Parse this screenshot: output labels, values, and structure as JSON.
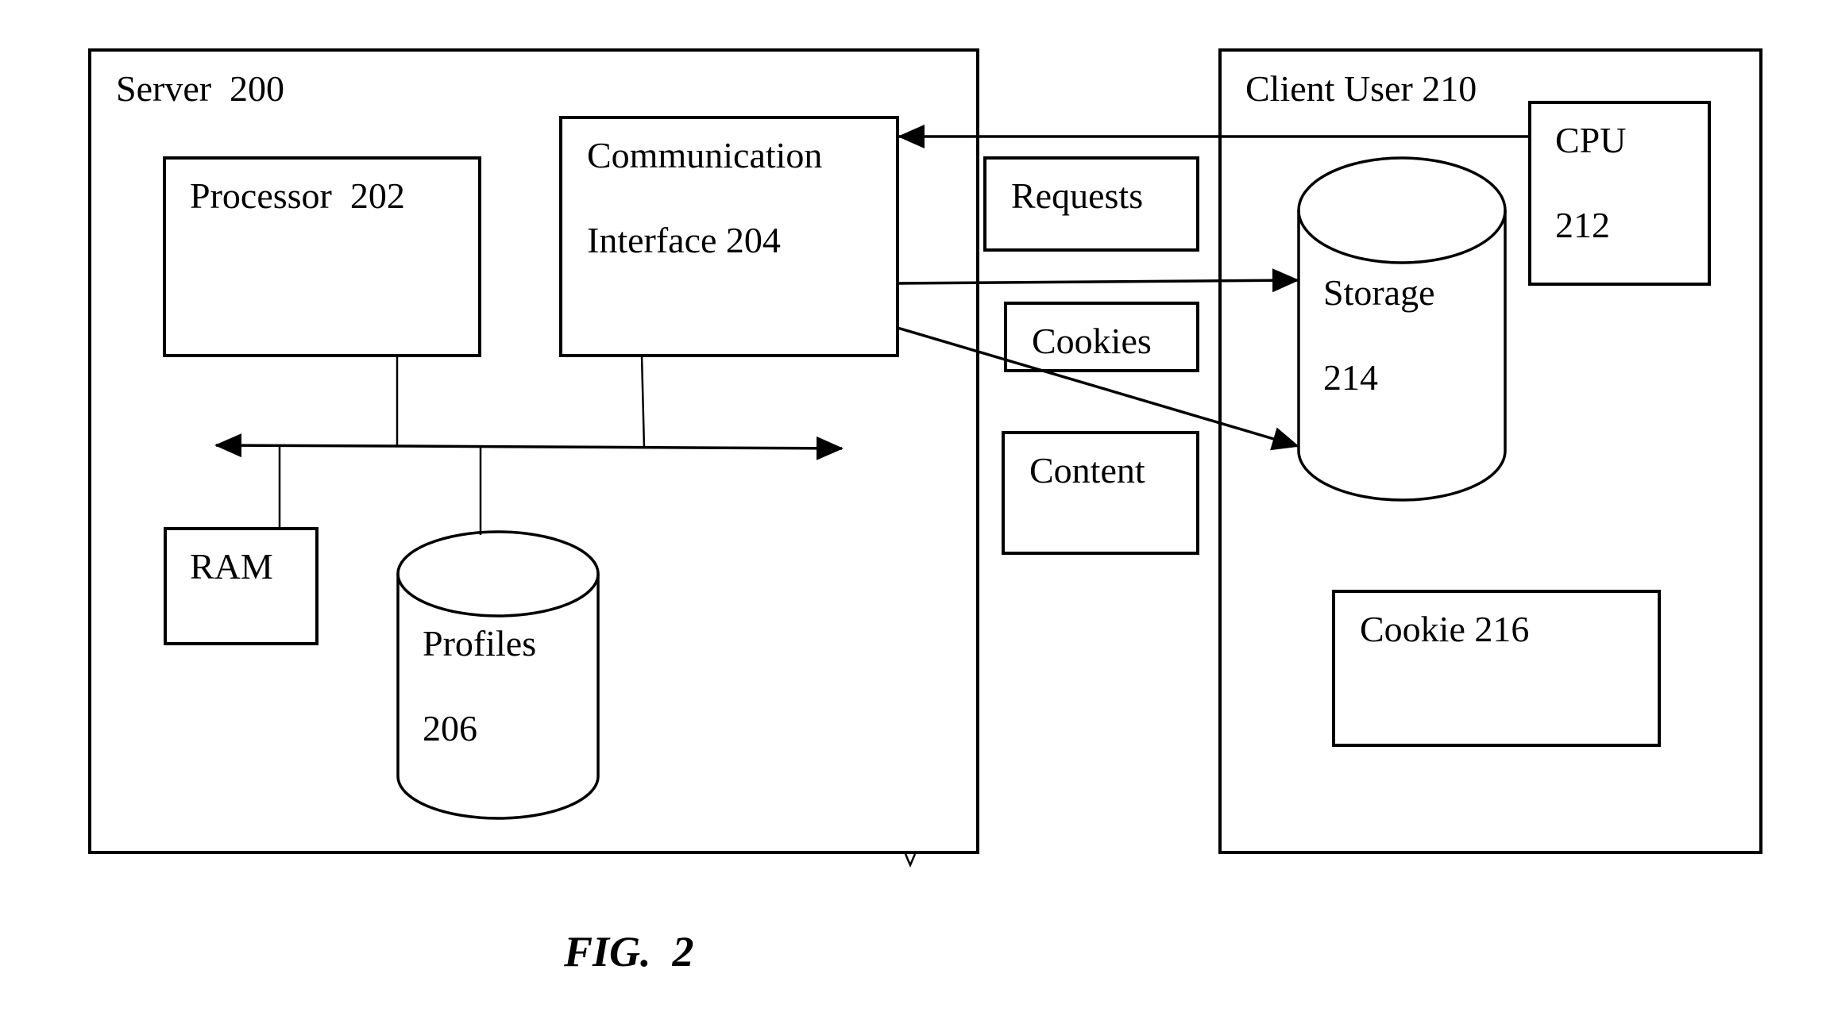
{
  "figure": {
    "caption": "FIG.  2",
    "server": {
      "label": "Server  200",
      "processor": "Processor  202",
      "comm_interface": [
        "Communication",
        "Interface 204"
      ],
      "ram": "RAM",
      "profiles": [
        "Profiles",
        "206"
      ]
    },
    "transfers": {
      "requests": "Requests",
      "cookies": "Cookies",
      "content": "Content"
    },
    "client": {
      "label": "Client User 210",
      "cpu": [
        "CPU",
        "212"
      ],
      "storage": [
        "Storage",
        "214"
      ],
      "cookie": "Cookie 216"
    },
    "connections": [
      {
        "from": "CPU 212",
        "to": "Communication Interface 204"
      },
      {
        "from": "Communication Interface 204",
        "to": "Storage 214"
      },
      {
        "from": "Communication Interface 204",
        "to": "Storage 214"
      },
      {
        "from": "Processor 202",
        "to": "bus"
      },
      {
        "from": "Communication Interface 204",
        "to": "bus"
      },
      {
        "from": "RAM",
        "to": "bus"
      },
      {
        "from": "Profiles 206",
        "to": "bus"
      }
    ]
  }
}
